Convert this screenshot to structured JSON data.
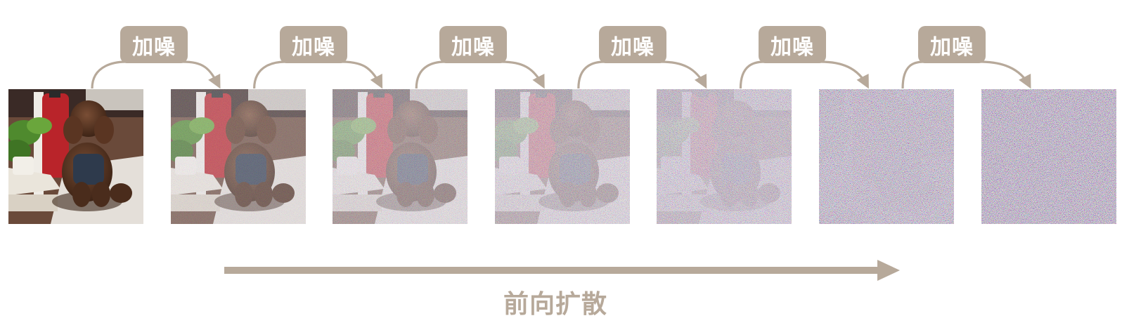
{
  "colors": {
    "accent": "#b7a99a",
    "badge_text": "#ffffff"
  },
  "steps": [
    {
      "label": "加噪"
    },
    {
      "label": "加噪"
    },
    {
      "label": "加噪"
    },
    {
      "label": "加噪"
    },
    {
      "label": "加噪"
    },
    {
      "label": "加噪"
    }
  ],
  "frames": [
    {
      "noise_level": 0.0
    },
    {
      "noise_level": 0.18
    },
    {
      "noise_level": 0.36
    },
    {
      "noise_level": 0.52
    },
    {
      "noise_level": 0.68
    },
    {
      "noise_level": 0.86
    },
    {
      "noise_level": 1.0
    }
  ],
  "process": {
    "label": "前向扩散"
  }
}
